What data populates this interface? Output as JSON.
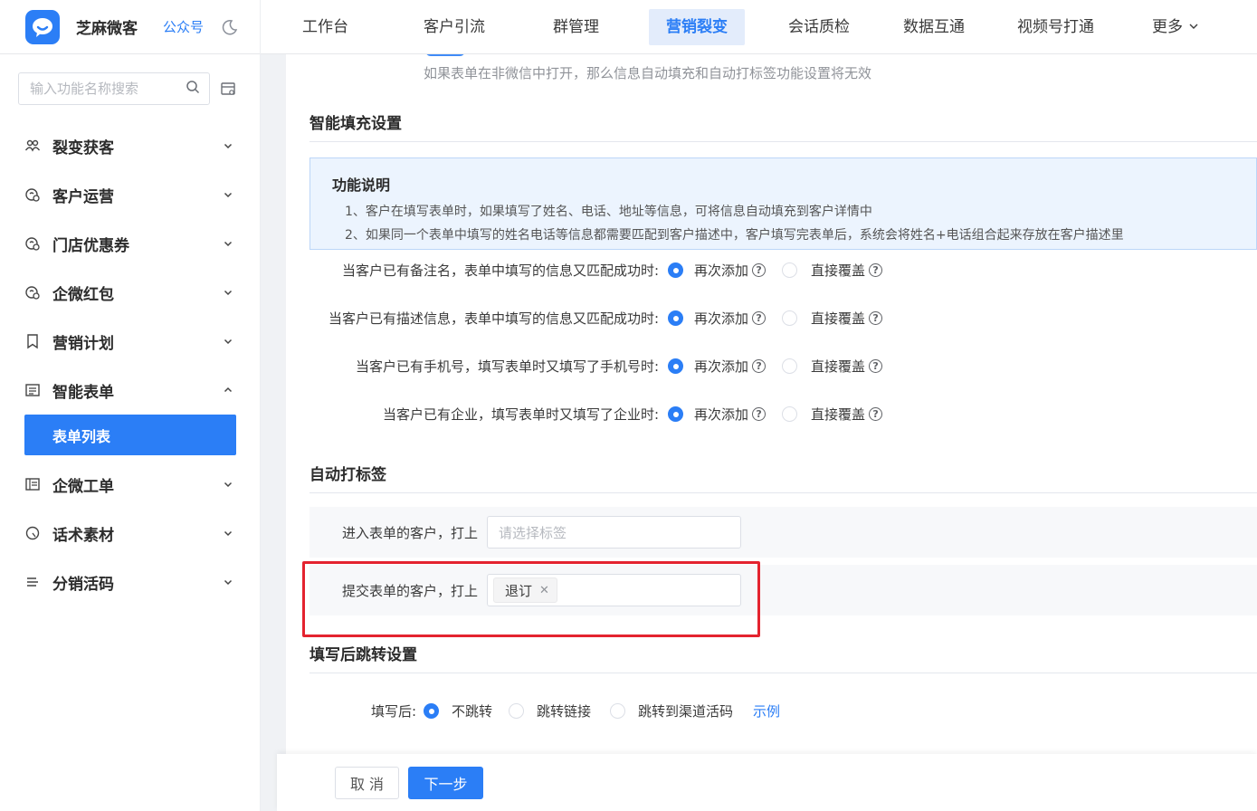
{
  "header": {
    "brand_name": "芝麻微客",
    "brand_link": "公众号",
    "nav": [
      {
        "label": "工作台"
      },
      {
        "label": "客户引流"
      },
      {
        "label": "群管理"
      },
      {
        "label": "营销裂变"
      },
      {
        "label": "会话质检"
      },
      {
        "label": "数据互通"
      },
      {
        "label": "视频号打通"
      },
      {
        "label": "更多"
      }
    ],
    "active_nav": "营销裂变"
  },
  "sidebar": {
    "search_placeholder": "输入功能名称搜索",
    "items": [
      {
        "label": "裂变获客",
        "icon": "users-icon"
      },
      {
        "label": "客户运营",
        "icon": "customer-icon"
      },
      {
        "label": "门店优惠券",
        "icon": "coupon-icon"
      },
      {
        "label": "企微红包",
        "icon": "redpacket-icon"
      },
      {
        "label": "营销计划",
        "icon": "bookmark-icon"
      },
      {
        "label": "智能表单",
        "icon": "form-icon"
      },
      {
        "label": "企微工单",
        "icon": "ticket-icon"
      },
      {
        "label": "话术素材",
        "icon": "material-icon"
      },
      {
        "label": "分销活码",
        "icon": "list-icon"
      }
    ],
    "active_sub": "表单列表"
  },
  "main": {
    "notice": "如果表单在非微信中打开，那么信息自动填充和自动打标签功能设置将无效",
    "autofill": {
      "title": "智能填充设置",
      "info_title": "功能说明",
      "info_lines": [
        "1、客户在填写表单时，如果填写了姓名、电话、地址等信息，可将信息自动填充到客户详情中",
        "2、如果同一个表单中填写的姓名电话等信息都需要匹配到客户描述中，客户填写完表单后，系统会将姓名+电话组合起来存放在客户描述里"
      ],
      "rows": [
        {
          "label": "当客户已有备注名，表单中填写的信息又匹配成功时:",
          "opt1": "再次添加",
          "opt2": "直接覆盖"
        },
        {
          "label": "当客户已有描述信息，表单中填写的信息又匹配成功时:",
          "opt1": "再次添加",
          "opt2": "直接覆盖"
        },
        {
          "label": "当客户已有手机号，填写表单时又填写了手机号时:",
          "opt1": "再次添加",
          "opt2": "直接覆盖"
        },
        {
          "label": "当客户已有企业，填写表单时又填写了企业时:",
          "opt1": "再次添加",
          "opt2": "直接覆盖"
        }
      ]
    },
    "autotag": {
      "title": "自动打标签",
      "enter_label": "进入表单的客户，打上",
      "enter_placeholder": "请选择标签",
      "submit_label": "提交表单的客户，打上",
      "submit_tag": "退订"
    },
    "redirect": {
      "title": "填写后跳转设置",
      "label": "填写后:",
      "options": [
        "不跳转",
        "跳转链接",
        "跳转到渠道活码"
      ],
      "example_link": "示例"
    }
  },
  "footer": {
    "cancel": "取 消",
    "next": "下一步"
  }
}
